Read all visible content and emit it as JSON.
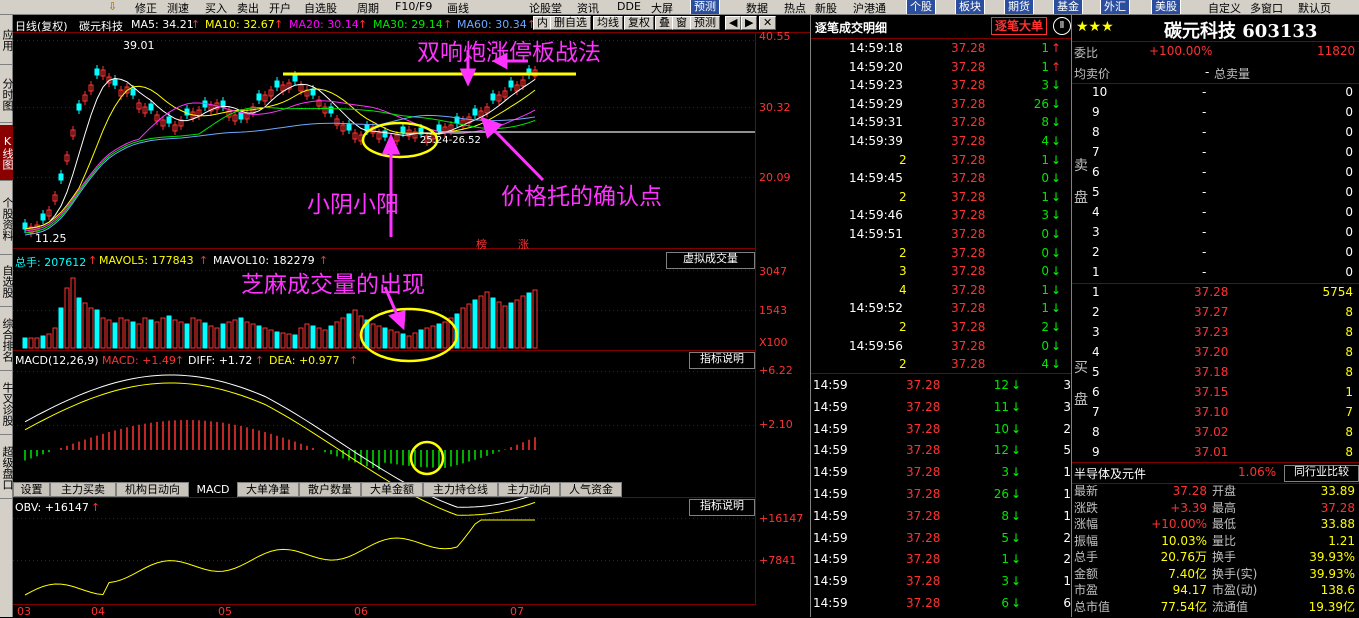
{
  "toolbar": {
    "items": [
      "修正",
      "测速",
      "买入",
      "卖出",
      "开户",
      "自选股",
      "周期",
      "F10/F9",
      "画线",
      "论股堂",
      "资讯",
      "DDE",
      "大屏"
    ],
    "buttons": [
      "预测",
      "数据",
      "热点",
      "新股",
      "沪港通"
    ],
    "tabs": [
      "个股",
      "板块",
      "期货",
      "基金",
      "外汇",
      "美股"
    ],
    "right_items": [
      "自定义",
      "多窗口",
      "默认页"
    ],
    "chart_tools": [
      "内",
      "删自选",
      "均线",
      "复权",
      "叠",
      "窗",
      "预测"
    ]
  },
  "left_nav": [
    "应用",
    "分时图",
    "K线图",
    "个股资料",
    "自选股",
    "综合排名",
    "牛叉诊股",
    "超级盘口"
  ],
  "kline_header": {
    "title": "日线(复权)",
    "name": "碳元科技",
    "ma5": "MA5: 34.21",
    "ma10": "MA10: 32.67",
    "ma20": "MA20: 30.14",
    "ma30": "MA30: 29.14",
    "ma60": "MA60: 30.34",
    "high_label": "39.01",
    "low_label": "11.25",
    "range_label": "25.24-26.52",
    "tags": [
      "榜",
      "涨"
    ],
    "y_labels": [
      "40.55",
      "30.32",
      "20.09"
    ]
  },
  "annotations": {
    "top": "双响炮涨停板战法",
    "left": "小阴小阳",
    "right": "价格托的确认点",
    "volume": "芝麻成交量的出现"
  },
  "volume_header": {
    "total": "总手: 207612",
    "mavol5": "MAVOL5: 177843",
    "mavol10": "MAVOL10: 182279",
    "button": "虚拟成交量",
    "y_labels": [
      "3047",
      "1543",
      "X100"
    ]
  },
  "macd_header": {
    "name": "MACD(12,26,9)",
    "macd": "MACD: +1.49",
    "diff": "DIFF: +1.72",
    "dea": "DEA: +0.977",
    "button": "指标说明",
    "y_labels": [
      "+6.22",
      "+2.10"
    ]
  },
  "bottom_tabs": [
    "设置",
    "主力买卖",
    "机构日动向",
    "MACD",
    "大单净量",
    "散户数量",
    "大单金额",
    "主力持仓线",
    "主力动向",
    "人气资金"
  ],
  "obv_header": {
    "label": "OBV: +16147",
    "button": "指标说明",
    "y_labels": [
      "+16147",
      "+7841"
    ]
  },
  "x_labels": [
    "03",
    "04",
    "05",
    "06",
    "07"
  ],
  "tape": {
    "title": "逐笔成交明细",
    "mode_button": "逐笔大单",
    "detail_rows": [
      {
        "time": "14:59:18",
        "price": "37.28",
        "vol": "1",
        "dir": "up"
      },
      {
        "time": "14:59:20",
        "price": "37.28",
        "vol": "1",
        "dir": "up"
      },
      {
        "time": "14:59:23",
        "price": "37.28",
        "vol": "3",
        "dir": "down"
      },
      {
        "time": "14:59:29",
        "price": "37.28",
        "vol": "26",
        "dir": "down"
      },
      {
        "time": "14:59:31",
        "price": "37.28",
        "vol": "8",
        "dir": "down"
      },
      {
        "time": "14:59:39",
        "price": "37.28",
        "vol": "4",
        "dir": "down"
      },
      {
        "time": "2",
        "price": "37.28",
        "vol": "1",
        "dir": "down"
      },
      {
        "time": "14:59:45",
        "price": "37.28",
        "vol": "0",
        "dir": "down"
      },
      {
        "time": "2",
        "price": "37.28",
        "vol": "1",
        "dir": "down"
      },
      {
        "time": "14:59:46",
        "price": "37.28",
        "vol": "3",
        "dir": "down"
      },
      {
        "time": "14:59:51",
        "price": "37.28",
        "vol": "0",
        "dir": "down"
      },
      {
        "time": "2",
        "price": "37.28",
        "vol": "0",
        "dir": "down"
      },
      {
        "time": "3",
        "price": "37.28",
        "vol": "0",
        "dir": "down"
      },
      {
        "time": "4",
        "price": "37.28",
        "vol": "1",
        "dir": "down"
      },
      {
        "time": "14:59:52",
        "price": "37.28",
        "vol": "1",
        "dir": "down"
      },
      {
        "time": "2",
        "price": "37.28",
        "vol": "2",
        "dir": "down"
      },
      {
        "time": "14:59:56",
        "price": "37.28",
        "vol": "0",
        "dir": "down"
      },
      {
        "time": "2",
        "price": "37.28",
        "vol": "4",
        "dir": "down"
      }
    ],
    "minute_rows": [
      {
        "time": "14:59",
        "price": "37.28",
        "vol": "12",
        "n": "3"
      },
      {
        "time": "14:59",
        "price": "37.28",
        "vol": "11",
        "n": "3"
      },
      {
        "time": "14:59",
        "price": "37.28",
        "vol": "10",
        "n": "2"
      },
      {
        "time": "14:59",
        "price": "37.28",
        "vol": "12",
        "n": "5"
      },
      {
        "time": "14:59",
        "price": "37.28",
        "vol": "3",
        "n": "1"
      },
      {
        "time": "14:59",
        "price": "37.28",
        "vol": "26",
        "n": "1"
      },
      {
        "time": "14:59",
        "price": "37.28",
        "vol": "8",
        "n": "1"
      },
      {
        "time": "14:59",
        "price": "37.28",
        "vol": "5",
        "n": "2"
      },
      {
        "time": "14:59",
        "price": "37.28",
        "vol": "1",
        "n": "2"
      },
      {
        "time": "14:59",
        "price": "37.28",
        "vol": "3",
        "n": "1"
      },
      {
        "time": "14:59",
        "price": "37.28",
        "vol": "6",
        "n": "6"
      }
    ]
  },
  "quote": {
    "stars": "★★★",
    "name": "碳元科技 603133",
    "webi_label": "委比",
    "webi_value": "+100.00%",
    "webi_count": "11820",
    "avg_label": "均卖价",
    "avg_value": "-",
    "total_label": "总卖量",
    "sell_label": [
      "卖",
      "盘"
    ],
    "buy_label": [
      "买",
      "盘"
    ],
    "sell_rows": [
      {
        "lvl": "10",
        "price": "-",
        "vol": "0"
      },
      {
        "lvl": "9",
        "price": "-",
        "vol": "0"
      },
      {
        "lvl": "8",
        "price": "-",
        "vol": "0"
      },
      {
        "lvl": "7",
        "price": "-",
        "vol": "0"
      },
      {
        "lvl": "6",
        "price": "-",
        "vol": "0"
      },
      {
        "lvl": "5",
        "price": "-",
        "vol": "0"
      },
      {
        "lvl": "4",
        "price": "-",
        "vol": "0"
      },
      {
        "lvl": "3",
        "price": "-",
        "vol": "0"
      },
      {
        "lvl": "2",
        "price": "-",
        "vol": "0"
      },
      {
        "lvl": "1",
        "price": "-",
        "vol": "0"
      }
    ],
    "buy_rows": [
      {
        "lvl": "1",
        "price": "37.28",
        "vol": "5754"
      },
      {
        "lvl": "2",
        "price": "37.27",
        "vol": "8"
      },
      {
        "lvl": "3",
        "price": "37.23",
        "vol": "8"
      },
      {
        "lvl": "4",
        "price": "37.20",
        "vol": "8"
      },
      {
        "lvl": "5",
        "price": "37.18",
        "vol": "8"
      },
      {
        "lvl": "6",
        "price": "37.15",
        "vol": "1"
      },
      {
        "lvl": "7",
        "price": "37.10",
        "vol": "7"
      },
      {
        "lvl": "8",
        "price": "37.02",
        "vol": "8"
      },
      {
        "lvl": "9",
        "price": "37.01",
        "vol": "8"
      }
    ],
    "sector": "半导体及元件",
    "sector_pct": "1.06%",
    "compare_button": "同行业比较",
    "stats": [
      {
        "l1": "最新",
        "v1": "37.28",
        "l2": "开盘",
        "v2": "33.89"
      },
      {
        "l1": "涨跌",
        "v1": "+3.39",
        "l2": "最高",
        "v2": "37.28"
      },
      {
        "l1": "涨幅",
        "v1": "+10.00%",
        "l2": "最低",
        "v2": "33.88"
      },
      {
        "l1": "振幅",
        "v1": "10.03%",
        "l2": "量比",
        "v2": "1.21"
      },
      {
        "l1": "总手",
        "v1": "20.76万",
        "l2": "换手",
        "v2": "39.93%"
      },
      {
        "l1": "金额",
        "v1": "7.40亿",
        "l2": "换手(实)",
        "v2": "39.93%"
      },
      {
        "l1": "市盈",
        "v1": "94.17",
        "l2": "市盈(动)",
        "v2": "138.6"
      },
      {
        "l1": "总市值",
        "v1": "77.54亿",
        "l2": "流通值",
        "v2": "19.39亿"
      }
    ]
  },
  "colors": {
    "up": "#ff3232",
    "down": "#00ffff",
    "yellow": "#ffff00",
    "magenta": "#ff33ff",
    "green": "#00e600"
  }
}
